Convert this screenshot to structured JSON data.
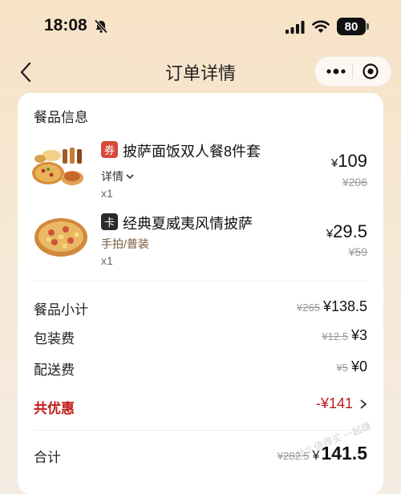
{
  "status_bar": {
    "time": "18:08",
    "battery": "80"
  },
  "nav": {
    "title": "订单详情"
  },
  "section_title": "餐品信息",
  "items": [
    {
      "tag": "券",
      "tag_color": "#d64a3a",
      "name": "披萨面饭双人餐8件套",
      "detail": "详情",
      "qty": "x1",
      "price": "109",
      "original_price": "¥206"
    },
    {
      "tag": "卡",
      "tag_color": "#2b2b2b",
      "name": "经典夏威夷风情披萨",
      "detail": "手拍/普装",
      "qty": "x1",
      "price": "29.5",
      "original_price": "¥59"
    }
  ],
  "summary": [
    {
      "label": "餐品小计",
      "strike": "¥265",
      "value": "¥138.5"
    },
    {
      "label": "包装费",
      "strike": "¥12.5",
      "value": "¥3"
    },
    {
      "label": "配送费",
      "strike": "¥5",
      "value": "¥0"
    }
  ],
  "discount": {
    "label": "共优惠",
    "value": "-¥141"
  },
  "total": {
    "label": "合计",
    "strike": "¥282.5",
    "value": "141.5",
    "currency": "¥"
  },
  "watermark": "什么值得买 一起赚",
  "colors": {
    "accent_red": "#c41a1a",
    "background": "#f6e7d2"
  }
}
